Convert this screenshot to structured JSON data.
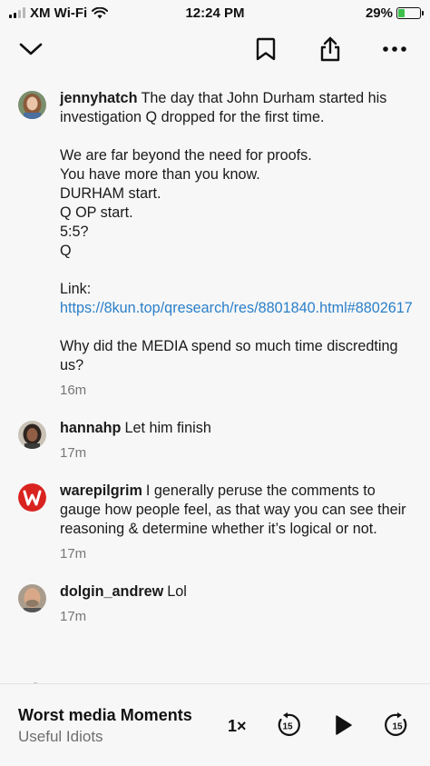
{
  "status_bar": {
    "carrier": "XM Wi-Fi",
    "time": "12:24 PM",
    "battery": "29%",
    "battery_level": 0.29
  },
  "nav": {
    "icons": [
      "chevron-down-icon",
      "bookmark-icon",
      "share-icon",
      "more-icon"
    ]
  },
  "comments": [
    {
      "user": "jennyhatch",
      "text": "The day that John Durham started his investigation Q dropped for the first time.\n\nWe are far beyond the need for proofs.\nYou have more than you know.\nDURHAM start.\nQ OP start.\n5:5?\nQ\n\n",
      "link_prefix": "Link: ",
      "link": "https://8kun.top/qresearch/res/8801840.html#8802617",
      "text_after": "\n\nWhy did the MEDIA spend so much time discredting us?",
      "time": "16m"
    },
    {
      "user": "hannahp",
      "text": "Let him finish",
      "time": "17m"
    },
    {
      "user": "warepilgrim",
      "text": "I generally peruse the comments to gauge how people feel, as that way you can see their reasoning & determine whether it’s logical or not.",
      "time": "17m"
    },
    {
      "user": "dolgin_andrew",
      "text": "Lol",
      "time": "17m"
    }
  ],
  "player": {
    "title": "Worst media Moments",
    "subtitle": "Useful Idiots",
    "speed": "1×",
    "skip_back": "15",
    "skip_forward": "15"
  },
  "colors": {
    "link": "#2a7fc9",
    "warepilgrim_avatar": "#d9231f",
    "battery_fill": "#3cc04a"
  }
}
